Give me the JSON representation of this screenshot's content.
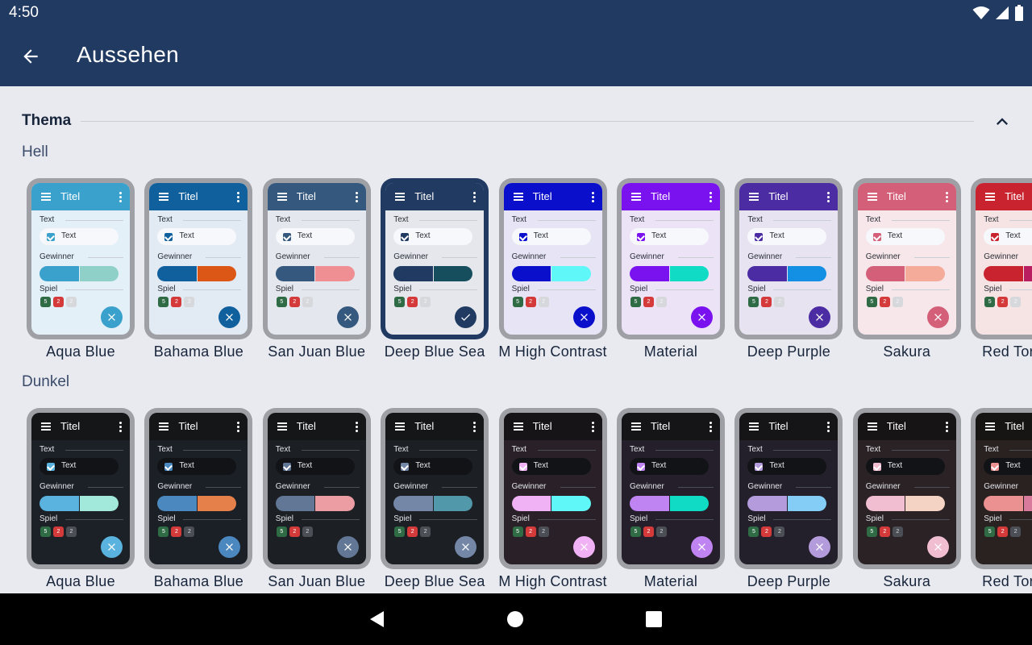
{
  "status_bar": {
    "time": "4:50"
  },
  "app_bar": {
    "title": "Aussehen"
  },
  "section": {
    "title": "Thema"
  },
  "preview": {
    "title": "Titel",
    "label_text": "Text",
    "checkbox_label": "Text",
    "label_winner": "Gewinner",
    "label_game": "Spiel",
    "chips": [
      "5",
      "2",
      "2"
    ]
  },
  "groups": [
    {
      "label": "Hell",
      "mode": "light",
      "themes": [
        {
          "name": "Aqua Blue",
          "selected": false,
          "colors": {
            "bar": "#3aa0cc",
            "bg": "#e3f0f8",
            "accent": "#3aa0cc",
            "accent2": "#8fd1c9",
            "fab": "#3aa0cc",
            "check": "#3aa0cc"
          }
        },
        {
          "name": "Bahama Blue",
          "selected": false,
          "colors": {
            "bar": "#10609e",
            "bg": "#e2eaf3",
            "accent": "#10609e",
            "accent2": "#dc5616",
            "fab": "#10609e",
            "check": "#10609e"
          }
        },
        {
          "name": "San Juan Blue",
          "selected": false,
          "colors": {
            "bar": "#34587e",
            "bg": "#e4e8ee",
            "accent": "#34587e",
            "accent2": "#ef8e93",
            "fab": "#34587e",
            "check": "#34587e"
          }
        },
        {
          "name": "Deep Blue Sea",
          "selected": true,
          "colors": {
            "bar": "#213a62",
            "bg": "#e5e7ec",
            "accent": "#213a62",
            "accent2": "#164e5d",
            "fab": "#213a62",
            "check": "#213a62"
          }
        },
        {
          "name": "M High Contrast",
          "selected": false,
          "colors": {
            "bar": "#0a0fcc",
            "bg": "#e7e5f5",
            "accent": "#0a0fcc",
            "accent2": "#5ff7f7",
            "fab": "#0a0fcc",
            "check": "#0a0fcc"
          }
        },
        {
          "name": "Material",
          "selected": false,
          "colors": {
            "bar": "#7a12f0",
            "bg": "#ece3f7",
            "accent": "#7a12f0",
            "accent2": "#10dbc5",
            "fab": "#7a12f0",
            "check": "#7a12f0"
          }
        },
        {
          "name": "Deep Purple",
          "selected": false,
          "colors": {
            "bar": "#4b2ca3",
            "bg": "#e7e3f0",
            "accent": "#4b2ca3",
            "accent2": "#138fe3",
            "fab": "#4b2ca3",
            "check": "#4b2ca3"
          }
        },
        {
          "name": "Sakura",
          "selected": false,
          "colors": {
            "bar": "#d35f78",
            "bg": "#f7e7ea",
            "accent": "#d35f78",
            "accent2": "#f4ab99",
            "fab": "#d35f78",
            "check": "#d35f78"
          }
        },
        {
          "name": "Red Tornado",
          "selected": false,
          "colors": {
            "bar": "#c8232f",
            "bg": "#f6e4e4",
            "accent": "#c8232f",
            "accent2": "#b91e60",
            "fab": "#c8232f",
            "check": "#c8232f"
          }
        }
      ]
    },
    {
      "label": "Dunkel",
      "mode": "dark",
      "themes": [
        {
          "name": "Aqua Blue",
          "selected": false,
          "colors": {
            "bar": "#141618",
            "bg": "#1b2126",
            "accent": "#59b3de",
            "accent2": "#a2e9dc",
            "fab": "#59b3de",
            "check": "#59b3de"
          }
        },
        {
          "name": "Bahama Blue",
          "selected": false,
          "colors": {
            "bar": "#141618",
            "bg": "#1b2026",
            "accent": "#4b88c0",
            "accent2": "#e5804b",
            "fab": "#4b88c0",
            "check": "#4b88c0"
          }
        },
        {
          "name": "San Juan Blue",
          "selected": false,
          "colors": {
            "bar": "#141618",
            "bg": "#1c2025",
            "accent": "#617795",
            "accent2": "#eb9da3",
            "fab": "#617795",
            "check": "#617795"
          }
        },
        {
          "name": "Deep Blue Sea",
          "selected": false,
          "colors": {
            "bar": "#141618",
            "bg": "#1c2025",
            "accent": "#7487a7",
            "accent2": "#5098aa",
            "fab": "#7487a7",
            "check": "#7487a7"
          }
        },
        {
          "name": "M High Contrast",
          "selected": false,
          "colors": {
            "bar": "#161416",
            "bg": "#2a2128",
            "accent": "#f0b1f5",
            "accent2": "#5ff7f7",
            "fab": "#f0b1f5",
            "check": "#f0b1f5"
          }
        },
        {
          "name": "Material",
          "selected": false,
          "colors": {
            "bar": "#151417",
            "bg": "#251f2c",
            "accent": "#bf84f2",
            "accent2": "#10dbc5",
            "fab": "#bf84f2",
            "check": "#bf84f2"
          }
        },
        {
          "name": "Deep Purple",
          "selected": false,
          "colors": {
            "bar": "#151417",
            "bg": "#231f2b",
            "accent": "#b49cdc",
            "accent2": "#83cdf6",
            "fab": "#b49cdc",
            "check": "#b49cdc"
          }
        },
        {
          "name": "Sakura",
          "selected": false,
          "colors": {
            "bar": "#171415",
            "bg": "#2a2224",
            "accent": "#f1bdd0",
            "accent2": "#f4d2c4",
            "fab": "#f1bdd0",
            "check": "#f1bdd0"
          }
        },
        {
          "name": "Red Tornado",
          "selected": false,
          "colors": {
            "bar": "#171414",
            "bg": "#2a2121",
            "accent": "#ec9191",
            "accent2": "#d87a9c",
            "fab": "#ec9191",
            "check": "#ec9191"
          }
        }
      ]
    }
  ]
}
